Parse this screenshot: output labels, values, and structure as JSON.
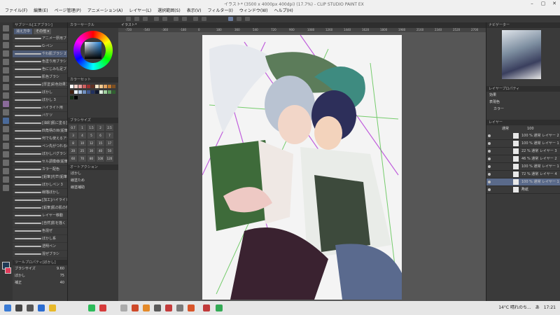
{
  "app": {
    "title": "イラスト* (3500 x 4000px 400dpi) (17.7%) - CLIP STUDIO PAINT EX",
    "menu": [
      "ファイル(F)",
      "編集(E)",
      "ページ管理(P)",
      "アニメーション(A)",
      "レイヤー(L)",
      "選択範囲(S)",
      "表示(V)",
      "フィルター(I)",
      "ウィンドウ(W)",
      "ヘルプ(H)"
    ]
  },
  "subtool": {
    "header": "サブツール[エアブラシ]",
    "tabs": [
      "消え方中",
      "その他 ▾"
    ],
    "brushes": [
      "アニメ一厚用ブラシ高品質 ガイド",
      "G-ペン",
      "やわ肌ブラシ 2",
      "色塗り用ブラシ",
      "色にじみも足ブラシ",
      "肌色ブラシ",
      "[厚塗]彩色効果ブラシ",
      "ぼかし",
      "ぼかし 3",
      "ハイライト用",
      "バケツ",
      "[油彩]肌に塗る塗るツール",
      "四角柄の目(鉛筆)",
      "何でも使えるアクセの仕上ブラシ",
      "ペン先がつれる(鉛筆)ブラシ",
      "ぼかしバグラシ",
      "セル調模様(鉛筆)",
      "カラー配色",
      "[鉛筆]光芒(鉛筆)ブラシ",
      "ぼかしペン 3",
      "線描ぼかし",
      "[加工]ハイライト",
      "[鉛筆]肌の肌の色テックス",
      "レイヤー移動",
      "[自然]影を描く",
      "色混ぜ",
      "ぼかし系",
      "透明ペン",
      "混ぜブラシ"
    ],
    "tool_property": "ツールプロパティ[ぼかし]",
    "brush_size_label": "ブラシサイズ",
    "brush_size": "9.60",
    "props": [
      {
        "label": "ぼかし",
        "value": "75"
      },
      {
        "label": "補正",
        "value": "40"
      }
    ]
  },
  "color": {
    "wheel_title": "カラーサークル",
    "palette_title": "カラーセット",
    "brush_size_title": "ブラシサイズ",
    "sizes_row1": [
      "0.7",
      "1",
      "1.5",
      "2",
      "2.5"
    ],
    "sizes_row2": [
      "3",
      "4",
      "5",
      "6",
      "7"
    ],
    "sizes_row3": [
      "8",
      "10",
      "12",
      "15",
      "17"
    ],
    "sizes_row4": [
      "20",
      "25",
      "30",
      "40",
      "50"
    ],
    "sizes_row5": [
      "60",
      "70",
      "80",
      "100",
      "120"
    ],
    "aux_title": "オートアクション",
    "aux_items": [
      "ぼかし",
      "線塗ため",
      "線塗補助"
    ]
  },
  "canvas": {
    "tab": "イラスト*",
    "zoom": "17.7",
    "ruler_marks": [
      "-720",
      "-540",
      "-360",
      "-180",
      "0",
      "180",
      "360",
      "540",
      "720",
      "900",
      "1080",
      "1260",
      "1440",
      "1620",
      "1800",
      "1980",
      "2160",
      "2340",
      "2520",
      "2700"
    ]
  },
  "right": {
    "navigator_title": "ナビゲーター",
    "layer_prop_title": "レイヤープロパティ",
    "effect_label": "効果",
    "expression_label": "表現色",
    "expression_value": "カラー",
    "layer_title": "レイヤー",
    "blend": "通常",
    "opacity": "100",
    "layers": [
      "100 % 通常 レイヤー 2",
      "100 % 通常 レイヤー 1",
      "22 % 通常 レイヤー 3",
      "46 % 通常 レイヤー 2",
      "100 % 通常 レイヤー 1",
      "72 % 通常 レイヤー 4",
      "100 % 通常 レイヤー 1 2",
      "用紙"
    ],
    "selected_layer": 6
  },
  "taskbar": {
    "weather": "14°C 晴れのち...",
    "time": "17:21",
    "lang": "あ"
  },
  "colors": {
    "accent": "#5a6a8a",
    "main_color": "#1e3a55",
    "sub_color": "#e03a5a"
  }
}
